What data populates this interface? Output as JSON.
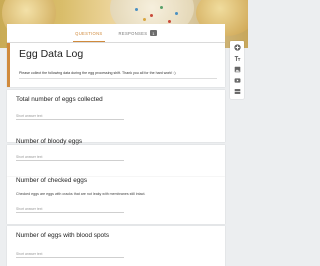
{
  "tabs": [
    {
      "label": "QUESTIONS",
      "active": true
    },
    {
      "label": "RESPONSES",
      "active": false,
      "count": "1"
    }
  ],
  "form": {
    "title": "Egg Data Log",
    "description": "Please collect the following data during the egg processing shift. Thank you all for the hard work! :)"
  },
  "questions": [
    {
      "title": "Total number of eggs collected",
      "help": "",
      "answer_placeholder": "Short answer text"
    },
    {
      "title": "Number of bloody eggs",
      "help": "",
      "answer_placeholder": "Short answer text"
    },
    {
      "title": "Number of checked eggs",
      "help": "Checked eggs are eggs with cracks that are not leaky with membranes still intact.",
      "answer_placeholder": "Short answer text"
    },
    {
      "title": "Number of eggs with blood spots",
      "help": "",
      "answer_placeholder": "Short answer text"
    }
  ],
  "toolbar": [
    {
      "icon": "add-question-icon"
    },
    {
      "icon": "add-title-icon"
    },
    {
      "icon": "add-image-icon"
    },
    {
      "icon": "add-video-icon"
    },
    {
      "icon": "add-section-icon"
    }
  ],
  "colors": {
    "accent": "#d08a3c",
    "background": "#eceef0"
  }
}
